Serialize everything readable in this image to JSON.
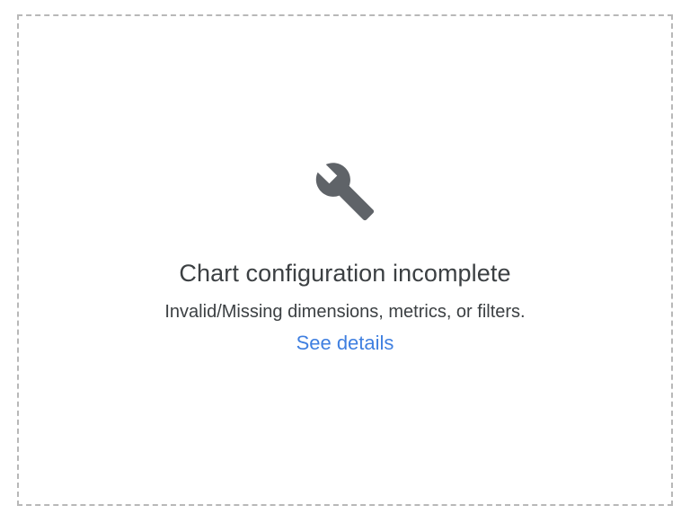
{
  "empty_state": {
    "icon": "wrench-icon",
    "title": "Chart configuration incomplete",
    "message": "Invalid/Missing dimensions, metrics, or filters.",
    "link_label": "See details"
  },
  "colors": {
    "icon": "#5f6368",
    "text": "#3c4043",
    "link": "#3f7fe0",
    "border": "#b8b8b8"
  }
}
